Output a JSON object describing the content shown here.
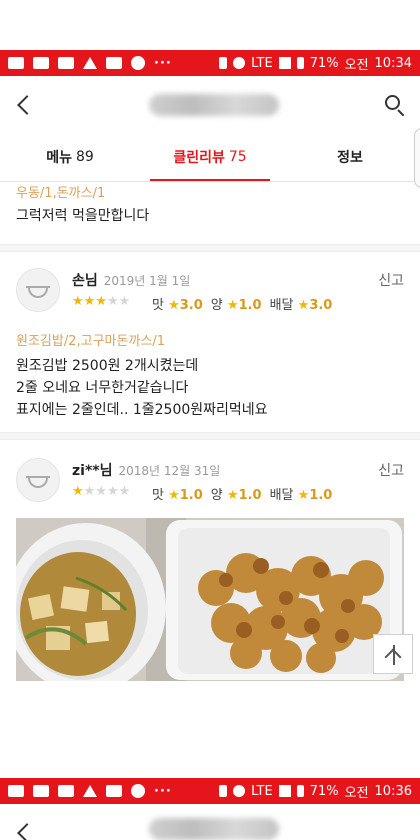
{
  "status_bar_top": {
    "icons": [
      "youtube-icon",
      "message-icon",
      "app-icon",
      "warning-icon",
      "inv-icon",
      "noodle-icon",
      "more-icon"
    ],
    "battery": "71%",
    "period": "오전",
    "time": "10:34",
    "network": "LTE"
  },
  "status_bar_bottom": {
    "battery": "71%",
    "period": "오전",
    "time": "10:36",
    "network": "LTE"
  },
  "tabs": [
    {
      "label": "메뉴",
      "count": "89"
    },
    {
      "label": "클린리뷰",
      "count": "75"
    },
    {
      "label": "정보",
      "count": ""
    }
  ],
  "snippet": {
    "menu": "우동/1,돈까스/1",
    "text": "그럭저럭 먹을만합니다"
  },
  "reviews": [
    {
      "name": "손님",
      "date": "2019년 1월 1일",
      "report": "신고",
      "rating": 3,
      "taste_label": "맛",
      "taste": "3.0",
      "amount_label": "양",
      "amount": "1.0",
      "delivery_label": "배달",
      "delivery": "3.0",
      "menu": "원조김밥/2,고구마돈까스/1",
      "lines": [
        "원조김밥 2500원 2개시켰는데",
        "2줄 오네요 너무한거같습니다",
        "표지에는 2줄인데.. 1줄2500원짜리먹네요"
      ]
    },
    {
      "name": "zi**님",
      "date": "2018년 12월 31일",
      "report": "신고",
      "rating": 1,
      "taste_label": "맛",
      "taste": "1.0",
      "amount_label": "양",
      "amount": "1.0",
      "delivery_label": "배달",
      "delivery": "1.0"
    }
  ],
  "colors": {
    "brand": "#e4161c",
    "star": "#f2b705",
    "menu_tag": "#d9a25a"
  }
}
